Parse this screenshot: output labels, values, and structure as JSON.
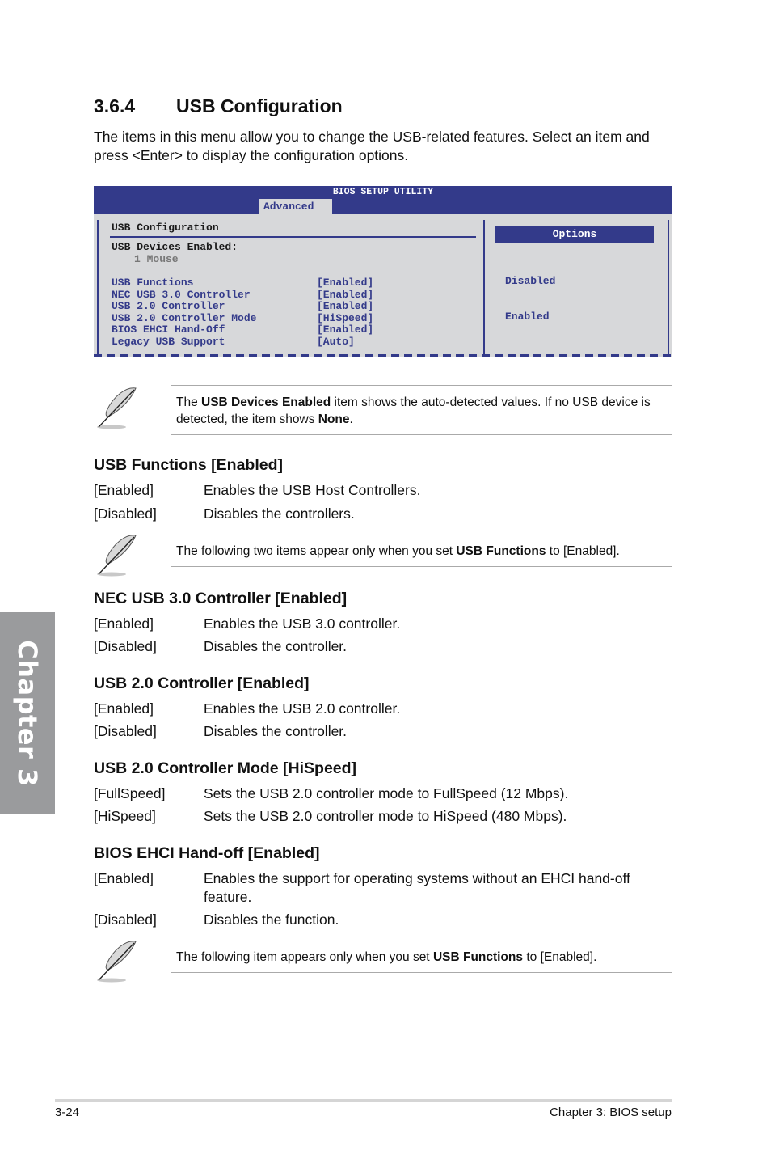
{
  "side_tab": {
    "label": "Chapter 3"
  },
  "section": {
    "number": "3.6.4",
    "title": "USB Configuration",
    "intro": "The items in this menu allow you to change the USB-related features. Select an item and press <Enter> to display the configuration options."
  },
  "bios": {
    "title": "BIOS SETUP UTILITY",
    "active_tab": "Advanced",
    "panel_title": "USB Configuration",
    "devices_label": "USB Devices Enabled:",
    "devices_value": "1 Mouse",
    "items": [
      {
        "label": "USB Functions",
        "value": "[Enabled]"
      },
      {
        "label": "NEC USB 3.0 Controller",
        "value": "[Enabled]"
      },
      {
        "label": "USB 2.0 Controller",
        "value": "[Enabled]"
      },
      {
        "label": "USB 2.0 Controller Mode",
        "value": "[HiSpeed]"
      },
      {
        "label": "BIOS EHCI Hand-Off",
        "value": "[Enabled]"
      },
      {
        "label": "Legacy USB Support",
        "value": "[Auto]"
      }
    ],
    "options_header": "Options",
    "options": [
      "Disabled",
      "Enabled"
    ],
    "colors": {
      "bar": "#333a8a",
      "panel": "#d7d8da"
    }
  },
  "notes": [
    {
      "pre": "The ",
      "bold": "USB Devices Enabled",
      "mid": " item shows the auto-detected values. If no USB device is detected, the item shows ",
      "bold2": "None",
      "post": "."
    },
    {
      "pre": "The following two items appear only when you set ",
      "bold": "USB Functions",
      "post": " to [Enabled]."
    },
    {
      "pre": "The following item appears only when you set ",
      "bold": "USB Functions",
      "post": " to [Enabled]."
    }
  ],
  "option_sections": [
    {
      "heading": "USB Functions [Enabled]",
      "rows": [
        {
          "key": "[Enabled]",
          "desc": "Enables the USB Host Controllers."
        },
        {
          "key": "[Disabled]",
          "desc": "Disables the controllers."
        }
      ]
    },
    {
      "heading": "NEC USB 3.0 Controller [Enabled]",
      "rows": [
        {
          "key": "[Enabled]",
          "desc": "Enables the USB 3.0 controller."
        },
        {
          "key": "[Disabled]",
          "desc": "Disables the controller."
        }
      ]
    },
    {
      "heading": "USB 2.0 Controller [Enabled]",
      "rows": [
        {
          "key": "[Enabled]",
          "desc": "Enables the USB 2.0 controller."
        },
        {
          "key": "[Disabled]",
          "desc": "Disables the controller."
        }
      ]
    },
    {
      "heading": "USB 2.0 Controller Mode [HiSpeed]",
      "rows": [
        {
          "key": "[FullSpeed]",
          "desc": "Sets the USB 2.0 controller mode to FullSpeed (12 Mbps)."
        },
        {
          "key": "[HiSpeed]",
          "desc": "Sets the USB 2.0 controller mode to HiSpeed (480 Mbps)."
        }
      ]
    },
    {
      "heading": "BIOS EHCI Hand-off [Enabled]",
      "rows": [
        {
          "key": "[Enabled]",
          "desc": "Enables the support for operating systems without an EHCI hand-off feature."
        },
        {
          "key": "[Disabled]",
          "desc": "Disables the function."
        }
      ]
    }
  ],
  "footer": {
    "page": "3-24",
    "chapter": "Chapter 3: BIOS setup"
  }
}
